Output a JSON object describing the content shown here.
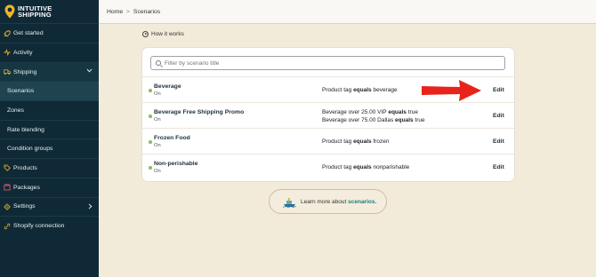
{
  "brand": {
    "line1": "INTUITIVE",
    "line2": "SHIPPING",
    "accent": "#f0b429"
  },
  "sidebar": {
    "items": [
      {
        "label": "Get started",
        "icon": "rocket-icon"
      },
      {
        "label": "Activity",
        "icon": "activity-icon"
      },
      {
        "label": "Shipping",
        "icon": "truck-icon",
        "expanded": true
      },
      {
        "label": "Scenarios"
      },
      {
        "label": "Zones"
      },
      {
        "label": "Rate blending"
      },
      {
        "label": "Condition groups"
      },
      {
        "label": "Products",
        "icon": "tag-icon"
      },
      {
        "label": "Packages",
        "icon": "package-icon"
      },
      {
        "label": "Settings",
        "icon": "gear-icon"
      },
      {
        "label": "Shopify connection",
        "icon": "link-icon"
      }
    ]
  },
  "breadcrumb": {
    "home": "Home",
    "separator": ">",
    "current": "Scenarios"
  },
  "how_it_works": "How it works",
  "filter": {
    "placeholder": "Filter by scenario title",
    "value": ""
  },
  "scenarios": [
    {
      "title": "Beverage",
      "status": "On",
      "conditions": [
        {
          "pre": "Product tag ",
          "op": "equals",
          "post": " beverage"
        }
      ],
      "action": "Edit"
    },
    {
      "title": "Beverage Free Shipping Promo",
      "status": "On",
      "conditions": [
        {
          "pre": "Beverage over 25.00 VIP ",
          "op": "equals",
          "post": " true"
        },
        {
          "pre": "Beverage over 75.00 Dallas ",
          "op": "equals",
          "post": " true"
        }
      ],
      "action": "Edit"
    },
    {
      "title": "Frozen Food",
      "status": "On",
      "conditions": [
        {
          "pre": "Product tag ",
          "op": "equals",
          "post": " frozen"
        }
      ],
      "action": "Edit"
    },
    {
      "title": "Non-perishable",
      "status": "On",
      "conditions": [
        {
          "pre": "Product tag ",
          "op": "equals",
          "post": " nonparishable"
        }
      ],
      "action": "Edit"
    }
  ],
  "learn_more": {
    "text": "Learn more about ",
    "link": "scenarios."
  },
  "colors": {
    "sidebar_bg": "#0f2a36",
    "page_bg": "#f3ebda",
    "status_dot": "#8bbf6a",
    "arrow": "#e8231b",
    "link": "#1a7f85"
  }
}
